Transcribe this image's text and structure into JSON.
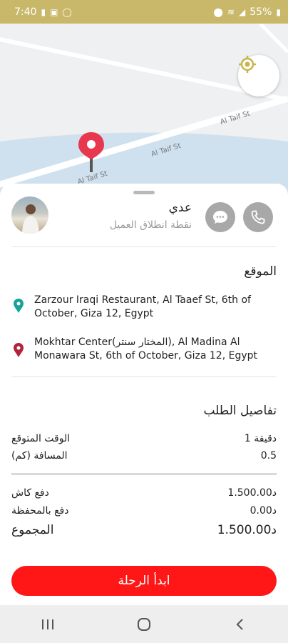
{
  "status_bar": {
    "time": "7:40",
    "left_icons": [
      "sim-icon",
      "gallery-icon",
      "whatsapp-icon"
    ],
    "right_icons": [
      "location-icon",
      "wifi-icon",
      "signal-icon"
    ],
    "battery": "55%"
  },
  "map": {
    "street_labels": [
      "Al Taif St",
      "Al Taif St",
      "Al Taif St"
    ],
    "pin_color": "#e8384f",
    "water_color": "#cfe0ee"
  },
  "driver_card": {
    "name": "عدي",
    "subtitle": "نقطة انطلاق العميل",
    "call_icon": "phone-icon",
    "chat_icon": "chat-icon"
  },
  "location_section": {
    "title": "الموقع",
    "pickup": {
      "address": "Zarzour Iraqi Restaurant, Al Taaef St, 6th of October, Giza 12, Egypt",
      "icon_color": "#17a398"
    },
    "dropoff": {
      "address": "Mokhtar Center(المختار سنتر), Al Madina Al Monawara St, 6th of October, Giza 12, Egypt",
      "icon_color": "#b1243c"
    }
  },
  "order_details": {
    "title": "تفاصيل الطلب",
    "rows": [
      {
        "label": "الوقت المتوقع",
        "value": "1 دقيقة"
      },
      {
        "label": "المسافة (كم)",
        "value": "0.5"
      }
    ]
  },
  "payment": {
    "rows": [
      {
        "label": "دفع كاش",
        "value": "د1.500.00"
      },
      {
        "label": "دفع بالمحفظة",
        "value": "د0.00"
      }
    ],
    "total": {
      "label": "المجموع",
      "value": "د1.500.00"
    }
  },
  "actions": {
    "start_trip_label": "ابدأ الرحلة",
    "accent_color": "#ff1717"
  }
}
